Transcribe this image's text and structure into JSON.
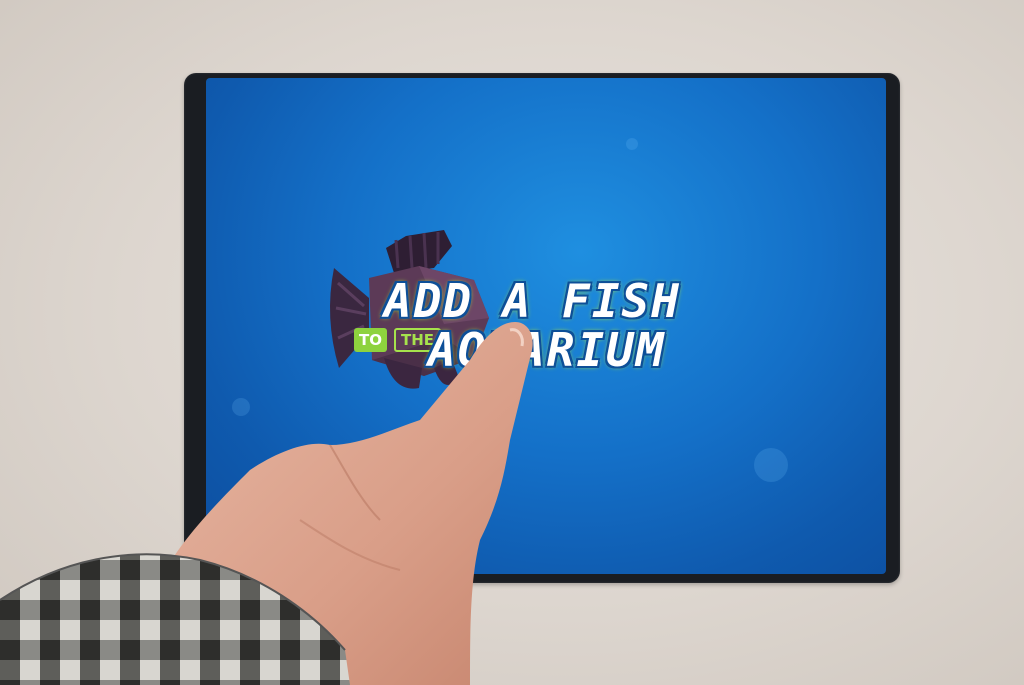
{
  "screen": {
    "title_line1": "ADD A FISH",
    "title_line2": "AQUARIUM",
    "tag_to": "TO",
    "tag_the": "THE"
  },
  "colors": {
    "screen_blue": "#1470c8",
    "title_outline": "#9ad94a",
    "tag_green": "#8ed23e"
  },
  "icons": {
    "fish": "fish-graphic",
    "hand": "pointing-hand"
  }
}
